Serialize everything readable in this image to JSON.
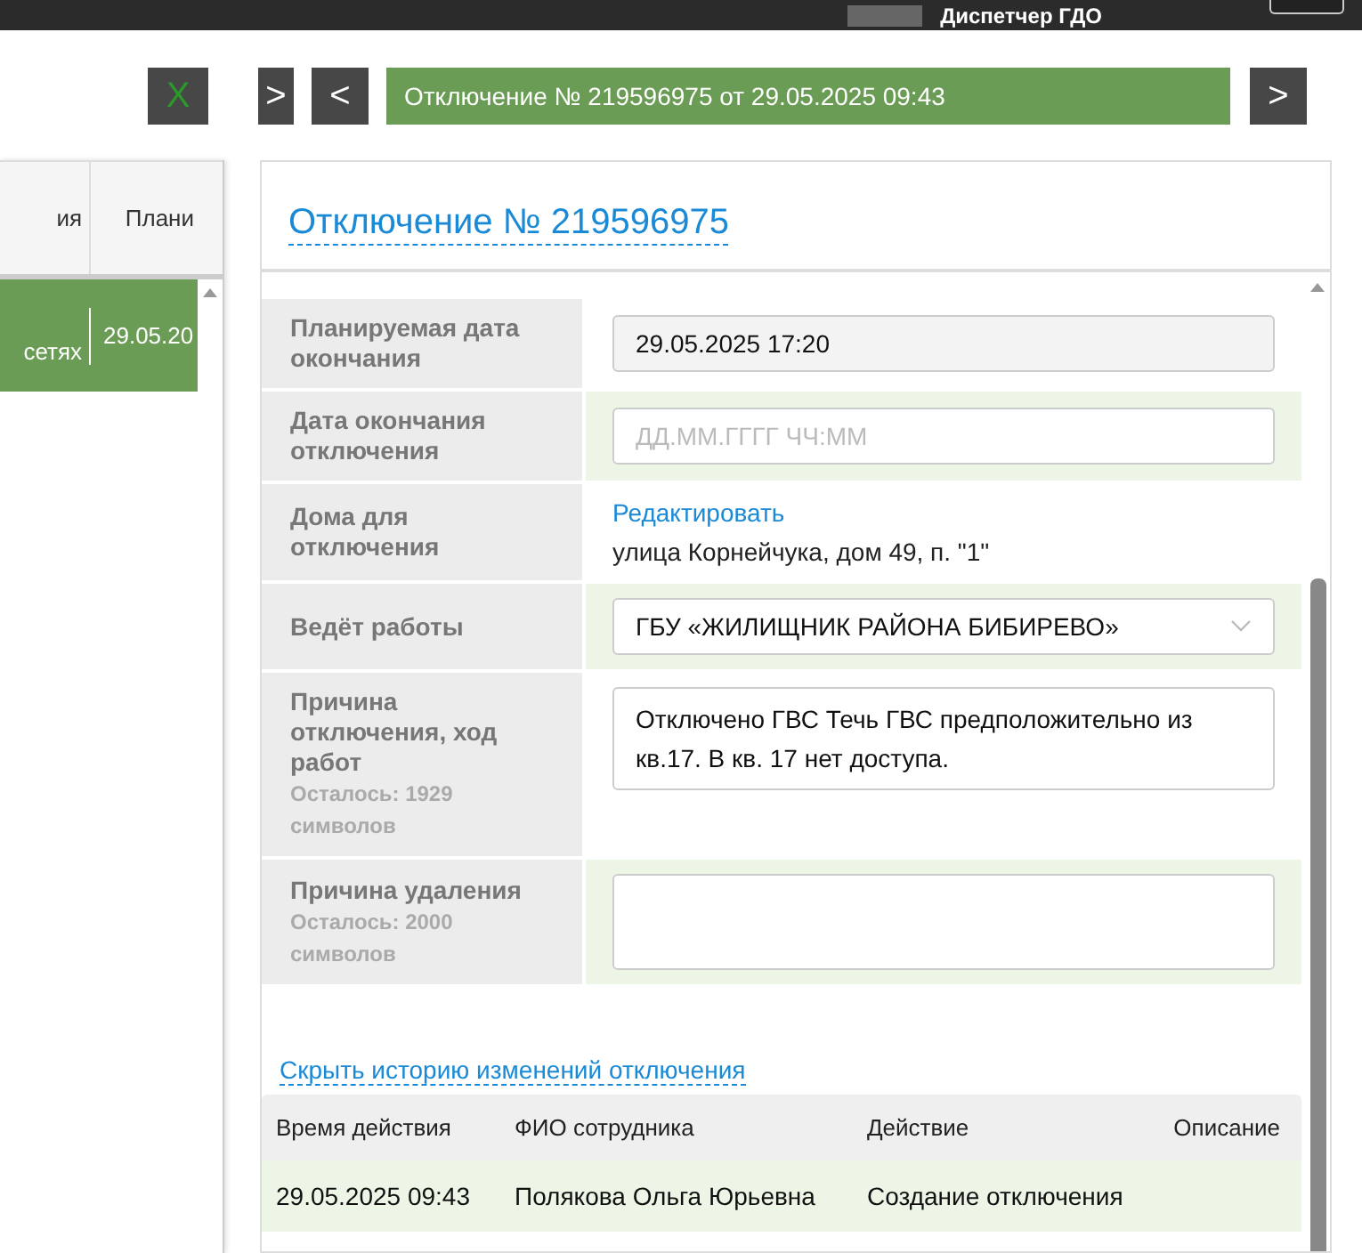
{
  "top_bar": {
    "user": "Диспетчер ГДО"
  },
  "toolbar": {
    "close_label": "X",
    "collapse_label": ">",
    "prev_label": "<",
    "title": "Отключение № 219596975 от 29.05.2025 09:43",
    "next_label": ">"
  },
  "list_table": {
    "columns": [
      "ия",
      "Плани"
    ],
    "rows": [
      {
        "cells": [
          "сетях",
          "29.05.20"
        ],
        "selected": true
      }
    ]
  },
  "card": {
    "title": "Отключение № 219596975",
    "fields": [
      {
        "kind": "disabled",
        "label": "Планируемая дата окончания",
        "value": "29.05.2025 17:20"
      },
      {
        "kind": "input",
        "label": "Дата окончания отключения",
        "placeholder": "ДД.ММ.ГГГГ ЧЧ:ММ"
      },
      {
        "kind": "houses",
        "label": "Дома для отключения",
        "link": "Редактировать",
        "value": "улица Корнейчука, дом 49, п. \"1\""
      },
      {
        "kind": "select",
        "label": "Ведёт работы",
        "value": "ГБУ «ЖИЛИЩНИК РАЙОНА БИБИРЕВО»"
      },
      {
        "kind": "textarea",
        "label": "Причина отключения, ход работ",
        "hint": "Осталось: 1929 символов",
        "value": "Отключено ГВС Течь ГВС предположительно из кв.17. В кв. 17 нет доступа."
      },
      {
        "kind": "textarea",
        "label": "Причина удаления",
        "hint": "Осталось: 2000 символов"
      }
    ],
    "history_link": "Скрыть историю изменений отключения",
    "history": {
      "columns": [
        "Время действия",
        "ФИО сотрудника",
        "Действие",
        "Описание"
      ],
      "rows": [
        [
          "29.05.2025 09:43",
          "Полякова Ольга Юрьевна",
          "Создание отключения"
        ]
      ]
    }
  }
}
